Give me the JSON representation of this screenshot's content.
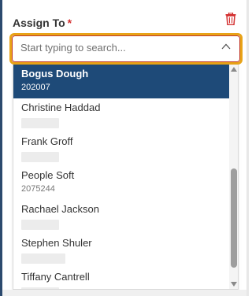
{
  "field": {
    "label": "Assign To",
    "required_marker": "*",
    "placeholder": "Start typing to search...",
    "delete_icon": "trash-icon",
    "toggle_icon": "chevron-up-icon"
  },
  "options": [
    {
      "name": "Bogus Dough",
      "id": "202007",
      "selected": true
    },
    {
      "name": "Christine Haddad",
      "id": ""
    },
    {
      "name": "Frank Groff",
      "id": ""
    },
    {
      "name": "People Soft",
      "id": "2075244"
    },
    {
      "name": "Rachael Jackson",
      "id": ""
    },
    {
      "name": "Stephen Shuler",
      "id": ""
    },
    {
      "name": "Tiffany Cantrell",
      "id": ""
    }
  ],
  "colors": {
    "accent_border": "#2c4a6e",
    "focus_ring": "#e8a317",
    "error_border": "#c0392b",
    "selected_bg": "#1e4a78",
    "required": "#d32f2f"
  }
}
